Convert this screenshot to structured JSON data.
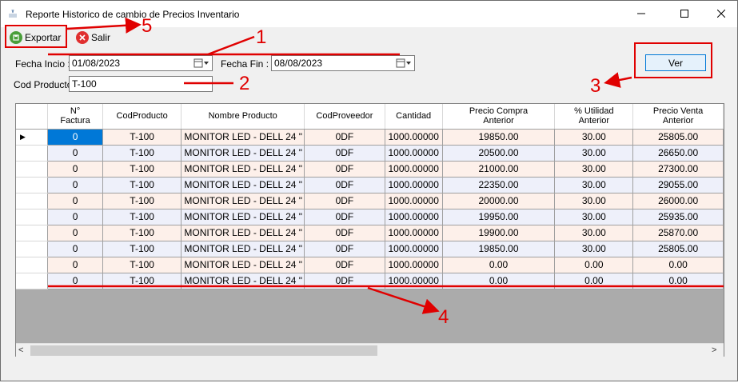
{
  "window": {
    "title": "Reporte Historico de cambio de Precios Inventario",
    "minimize": "—",
    "maximize": "☐",
    "close": "✕"
  },
  "toolbar": {
    "export_label": "Exportar",
    "exit_label": "Salir"
  },
  "filters": {
    "fecha_inicio_label": "Fecha Incio :",
    "fecha_inicio_value": "01/08/2023",
    "fecha_fin_label": "Fecha Fin :",
    "fecha_fin_value": "08/08/2023",
    "cod_producto_label": "Cod Producto:",
    "cod_producto_value": "T-100",
    "ver_label": "Ver"
  },
  "grid": {
    "columns": [
      {
        "line1": "N°",
        "line2": "Factura"
      },
      {
        "line1": "CodProducto",
        "line2": ""
      },
      {
        "line1": "Nombre Producto",
        "line2": ""
      },
      {
        "line1": "CodProveedor",
        "line2": ""
      },
      {
        "line1": "Cantidad",
        "line2": ""
      },
      {
        "line1": "Precio Compra",
        "line2": "Anterior"
      },
      {
        "line1": "% Utilidad",
        "line2": "Anterior"
      },
      {
        "line1": "Precio Venta",
        "line2": "Anterior"
      }
    ],
    "rows": [
      [
        "0",
        "T-100",
        "MONITOR LED - DELL  24 \"",
        "0DF",
        "1000.00000",
        "19850.00",
        "30.00",
        "25805.00"
      ],
      [
        "0",
        "T-100",
        "MONITOR LED - DELL  24 \"",
        "0DF",
        "1000.00000",
        "20500.00",
        "30.00",
        "26650.00"
      ],
      [
        "0",
        "T-100",
        "MONITOR LED - DELL  24 \"",
        "0DF",
        "1000.00000",
        "21000.00",
        "30.00",
        "27300.00"
      ],
      [
        "0",
        "T-100",
        "MONITOR LED - DELL  24 \"",
        "0DF",
        "1000.00000",
        "22350.00",
        "30.00",
        "29055.00"
      ],
      [
        "0",
        "T-100",
        "MONITOR LED - DELL  24 \"",
        "0DF",
        "1000.00000",
        "20000.00",
        "30.00",
        "26000.00"
      ],
      [
        "0",
        "T-100",
        "MONITOR LED - DELL  24 \"",
        "0DF",
        "1000.00000",
        "19950.00",
        "30.00",
        "25935.00"
      ],
      [
        "0",
        "T-100",
        "MONITOR LED - DELL  24 \"",
        "0DF",
        "1000.00000",
        "19900.00",
        "30.00",
        "25870.00"
      ],
      [
        "0",
        "T-100",
        "MONITOR LED - DELL  24 \"",
        "0DF",
        "1000.00000",
        "19850.00",
        "30.00",
        "25805.00"
      ],
      [
        "0",
        "T-100",
        "MONITOR LED - DELL  24 \"",
        "0DF",
        "1000.00000",
        "0.00",
        "0.00",
        "0.00"
      ],
      [
        "0",
        "T-100",
        "MONITOR LED - DELL  24 \"",
        "0DF",
        "1000.00000",
        "0.00",
        "0.00",
        "0.00"
      ]
    ],
    "current_row_marker": "▶",
    "scroll_left": "<",
    "scroll_right": ">"
  },
  "annotations": [
    "1",
    "2",
    "3",
    "4",
    "5"
  ],
  "colors": {
    "annotation_red": "#e00000",
    "selection_blue": "#0078d7",
    "row_even": "#fdf0ea",
    "row_odd": "#eef0fa",
    "grid_background": "#ababab"
  }
}
